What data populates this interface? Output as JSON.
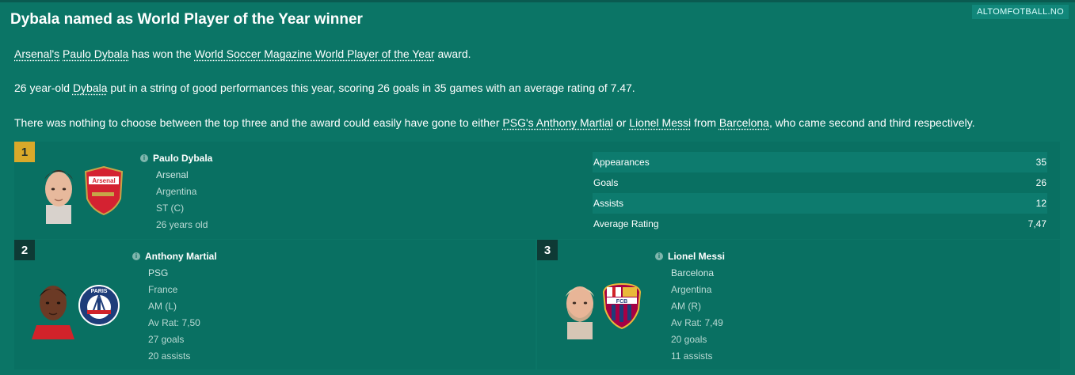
{
  "watermark": "ALTOMFOTBALL.NO",
  "title": "Dybala named as World Player of the Year winner",
  "para1": {
    "club": "Arsenal's",
    "player": "Paulo Dybala",
    "mid": " has won the ",
    "award": "World Soccer Magazine World Player of the Year",
    "end": " award."
  },
  "para2": {
    "start": "26 year-old ",
    "player": "Dybala",
    "end": " put in a string of good performances this year, scoring 26 goals in 35 games with an average rating of 7.47."
  },
  "para3": {
    "start": "There was nothing to choose between the top three and the award could easily have gone to either ",
    "p2": "PSG's Anthony Martial",
    "or": " or ",
    "p3": "Lionel Messi",
    "from": " from ",
    "club3": "Barcelona",
    "end": ", who came second and third respectively."
  },
  "winner": {
    "rank": "1",
    "name": "Paulo Dybala",
    "club": "Arsenal",
    "nation": "Argentina",
    "position": "ST (C)",
    "age": "26 years old",
    "stats": [
      {
        "label": "Appearances",
        "value": "35"
      },
      {
        "label": "Goals",
        "value": "26"
      },
      {
        "label": "Assists",
        "value": "12"
      },
      {
        "label": "Average Rating",
        "value": "7,47"
      }
    ]
  },
  "second": {
    "rank": "2",
    "name": "Anthony Martial",
    "club": "PSG",
    "nation": "France",
    "position": "AM (L)",
    "rating": "Av Rat: 7,50",
    "goals": "27 goals",
    "assists": "20 assists"
  },
  "third": {
    "rank": "3",
    "name": "Lionel Messi",
    "club": "Barcelona",
    "nation": "Argentina",
    "position": "AM (R)",
    "rating": "Av Rat: 7,49",
    "goals": "20 goals",
    "assists": "11 assists"
  },
  "crests": {
    "arsenal": "Arsenal",
    "psg": "PARIS",
    "barca": "FCB"
  },
  "colors": {
    "background": "#0b7566",
    "rank1": "#d9a92a",
    "rank_other": "#0e3a35"
  }
}
